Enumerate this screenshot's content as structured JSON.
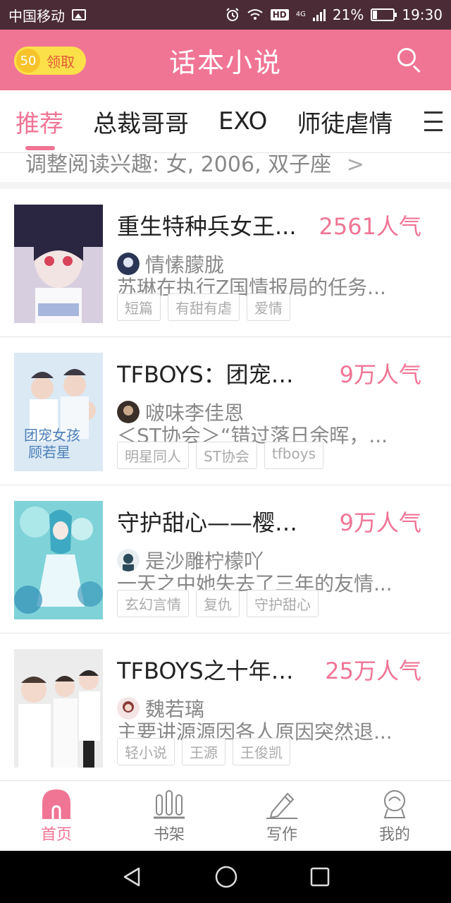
{
  "status_bar": {
    "carrier": "中国移动",
    "hd": "HD",
    "network": "4G",
    "battery_percent": "21%",
    "battery_level": 0.21,
    "time": "19:30"
  },
  "header": {
    "coins": "50",
    "claim_label": "领取",
    "title": "话本小说"
  },
  "tabs": [
    {
      "label": "推荐"
    },
    {
      "label": "总裁哥哥"
    },
    {
      "label": "EXO"
    },
    {
      "label": "师徒虐情"
    }
  ],
  "interest": {
    "text": "调整阅读兴趣: 女, 2006, 双子座",
    "chevron": ">"
  },
  "books": [
    {
      "title": "重生特种兵女王...",
      "popularity": "2561人气",
      "author": "情愫朦胧",
      "description": "苏琳在执行Z国情报局的任务...",
      "tags": [
        "短篇",
        "有甜有虐",
        "爱情"
      ],
      "cover_color": "#c9b7cf",
      "avatar_color": "#2a3556"
    },
    {
      "title": "TFBOYS：团宠女...",
      "popularity": "9万人气",
      "author": "啵味李佳恩",
      "description": "＜ST协会＞“错过落日余晖，...",
      "tags": [
        "明星同人",
        "ST协会",
        "tfboys"
      ],
      "cover_color": "#d9e8f4",
      "avatar_color": "#3a2f28"
    },
    {
      "title": "守护甜心——樱血...",
      "popularity": "9万人气",
      "author": "是沙雕柠檬吖",
      "description": "一天之中她失去了三年的友情...",
      "tags": [
        "玄幻言情",
        "复仇",
        "守护甜心"
      ],
      "cover_color": "#7fd3d8",
      "avatar_color": "#2b4b5a"
    },
    {
      "title": "TFBOYS之十年之...",
      "popularity": "25万人气",
      "author": "魏若璃",
      "description": "主要讲源源因各人原因突然退...",
      "tags": [
        "轻小说",
        "王源",
        "王俊凯"
      ],
      "cover_color": "#e9e9ea",
      "avatar_color": "#8a3a3a"
    }
  ],
  "bottom_nav": [
    {
      "label": "首页",
      "icon": "home-icon",
      "active": true
    },
    {
      "label": "书架",
      "icon": "bookshelf-icon",
      "active": false
    },
    {
      "label": "写作",
      "icon": "pencil-icon",
      "active": false
    },
    {
      "label": "我的",
      "icon": "profile-icon",
      "active": false
    }
  ],
  "colors": {
    "accent": "#f07594",
    "status_bar": "#4a2b36",
    "coin": "#fce04a"
  }
}
